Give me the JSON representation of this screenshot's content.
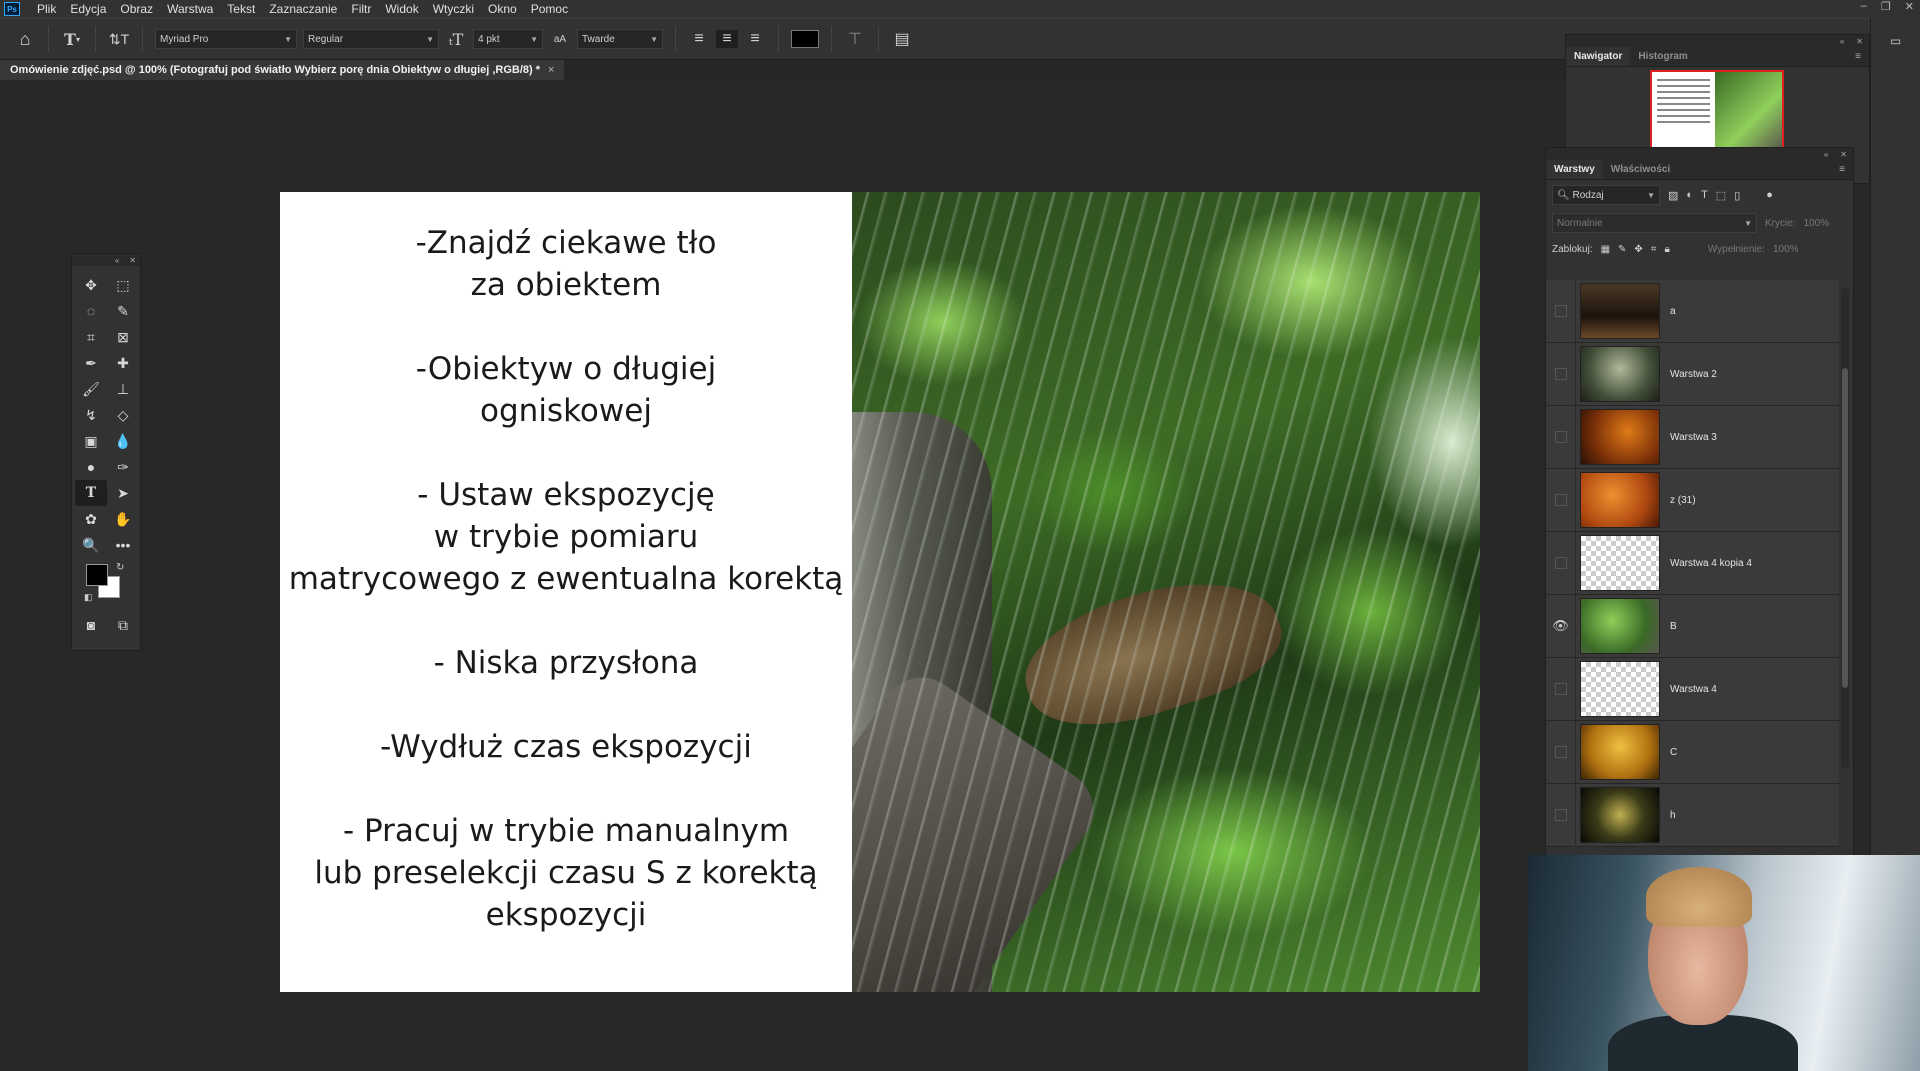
{
  "menu": {
    "items": [
      "Plik",
      "Edycja",
      "Obraz",
      "Warstwa",
      "Tekst",
      "Zaznaczanie",
      "Filtr",
      "Widok",
      "Wtyczki",
      "Okno",
      "Pomoc"
    ]
  },
  "options": {
    "font_family": "Myriad Pro",
    "font_style": "Regular",
    "font_size": "4 pkt",
    "aa_mode": "Twarde",
    "aa_icon": "aA",
    "color": "#000000"
  },
  "document": {
    "tab_title": "Omówienie zdjęć.psd @ 100% (Fotografuj pod światło  Wybierz porę dnia  Obiektyw o długiej ,RGB/8) *",
    "close": "×"
  },
  "slide": {
    "paragraphs": [
      "-Znajdź ciekawe tło\nza obiektem",
      "-Obiektyw o długiej\nogniskowej",
      "- Ustaw ekspozycję\nw trybie pomiaru\nmatrycowego z ewentualna korektą",
      "- Niska przysłona",
      "-Wydłuż czas ekspozycji",
      "- Pracuj w trybie manualnym\nlub preselekcji czasu S z korektą\nekspozycji"
    ]
  },
  "navigator": {
    "tabs": [
      "Nawigator",
      "Histogram"
    ]
  },
  "layers_panel": {
    "tabs": [
      "Warstwy",
      "Właściwości"
    ],
    "filter_label": "Rodzaj",
    "blend_mode": "Normalnie",
    "opacity_label": "Krycie:",
    "opacity_value": "100%",
    "lock_label": "Zablokuj:",
    "fill_label": "Wypełnienie:",
    "fill_value": "100%",
    "layers": [
      {
        "name": "a",
        "visible": false,
        "thumb": "t-dark"
      },
      {
        "name": "Warstwa 2",
        "visible": false,
        "thumb": "t-leaf"
      },
      {
        "name": "Warstwa 3",
        "visible": false,
        "thumb": "t-orange"
      },
      {
        "name": "z (31)",
        "visible": false,
        "thumb": "t-rust"
      },
      {
        "name": "Warstwa 4 kopia 4",
        "visible": false,
        "thumb": "t-check"
      },
      {
        "name": "B",
        "visible": true,
        "thumb": "t-green"
      },
      {
        "name": "Warstwa 4",
        "visible": false,
        "thumb": "t-check"
      },
      {
        "name": "C",
        "visible": false,
        "thumb": "t-gold"
      },
      {
        "name": "h",
        "visible": false,
        "thumb": "t-night"
      }
    ]
  },
  "icons": {
    "home": "⌂",
    "eye": "👁"
  }
}
